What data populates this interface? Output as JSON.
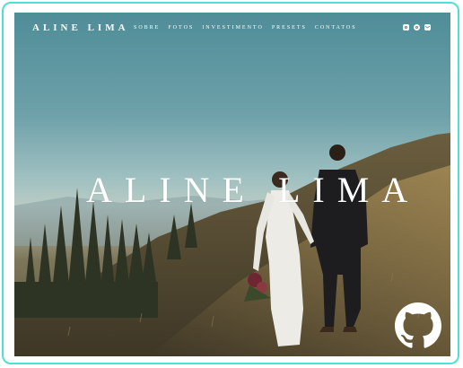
{
  "nav": {
    "brand": "ALINE LIMA",
    "items": [
      "SOBRE",
      "FOTOS",
      "INVESTIMENTO",
      "PRESETS",
      "CONTATOS"
    ]
  },
  "socials": [
    "instagram-icon",
    "whatsapp-icon",
    "email-icon"
  ],
  "hero": {
    "title": "ALINE LIMA"
  },
  "badge": {
    "icon": "github-icon"
  },
  "colors": {
    "frame": "#4fe0d4",
    "text": "#ffffff"
  }
}
